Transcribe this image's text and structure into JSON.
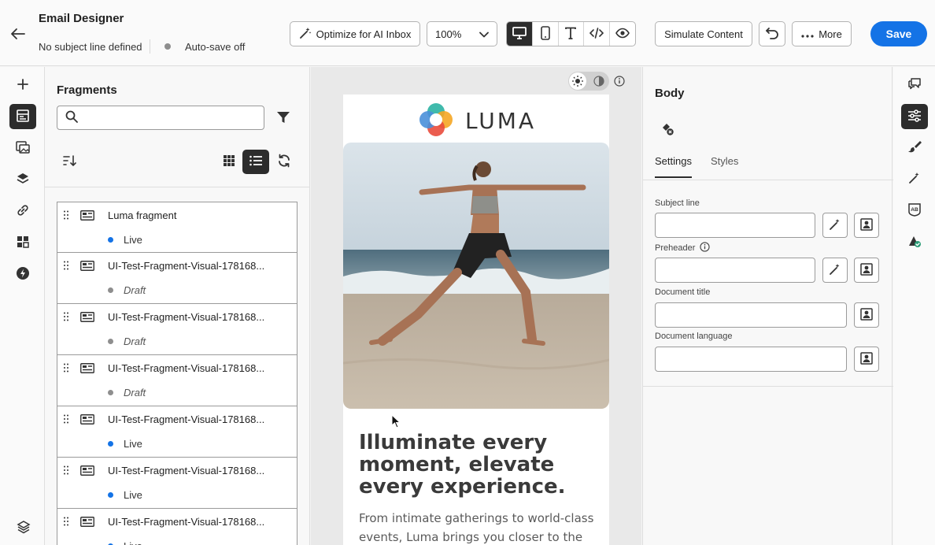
{
  "header": {
    "title": "Email Designer",
    "subject_status": "No subject line defined",
    "autosave": "Auto-save off",
    "optimize_label": "Optimize for AI Inbox",
    "zoom": "100%",
    "simulate_label": "Simulate Content",
    "more_label": "More",
    "save_label": "Save",
    "view_modes": [
      "desktop-icon",
      "mobile-icon",
      "text-icon",
      "code-icon",
      "preview-eye-icon"
    ],
    "active_view": "desktop-icon"
  },
  "fragments": {
    "title": "Fragments",
    "search_placeholder": "",
    "items": [
      {
        "name": "Luma fragment",
        "status": "Live"
      },
      {
        "name": "UI-Test-Fragment-Visual-178168...",
        "status": "Draft"
      },
      {
        "name": "UI-Test-Fragment-Visual-178168...",
        "status": "Draft"
      },
      {
        "name": "UI-Test-Fragment-Visual-178168...",
        "status": "Draft"
      },
      {
        "name": "UI-Test-Fragment-Visual-178168...",
        "status": "Live"
      },
      {
        "name": "UI-Test-Fragment-Visual-178168...",
        "status": "Live"
      },
      {
        "name": "UI-Test-Fragment-Visual-178168...",
        "status": "Live"
      }
    ]
  },
  "email": {
    "logo_text": "LUMA",
    "headline": "Illuminate every moment, elevate every experience.",
    "body": "From intimate gatherings to world-class events, Luma brings you closer to the"
  },
  "properties": {
    "title": "Body",
    "tabs": [
      "Settings",
      "Styles"
    ],
    "active_tab": "Settings",
    "fields": {
      "subject_line": {
        "label": "Subject line",
        "value": ""
      },
      "preheader": {
        "label": "Preheader",
        "value": ""
      },
      "document_title": {
        "label": "Document title",
        "value": ""
      },
      "document_language": {
        "label": "Document language",
        "value": ""
      }
    }
  },
  "colors": {
    "accent": "#1473e6",
    "live": "#1473e6",
    "draft": "#8e8e8e",
    "dark": "#2c2c2c"
  }
}
